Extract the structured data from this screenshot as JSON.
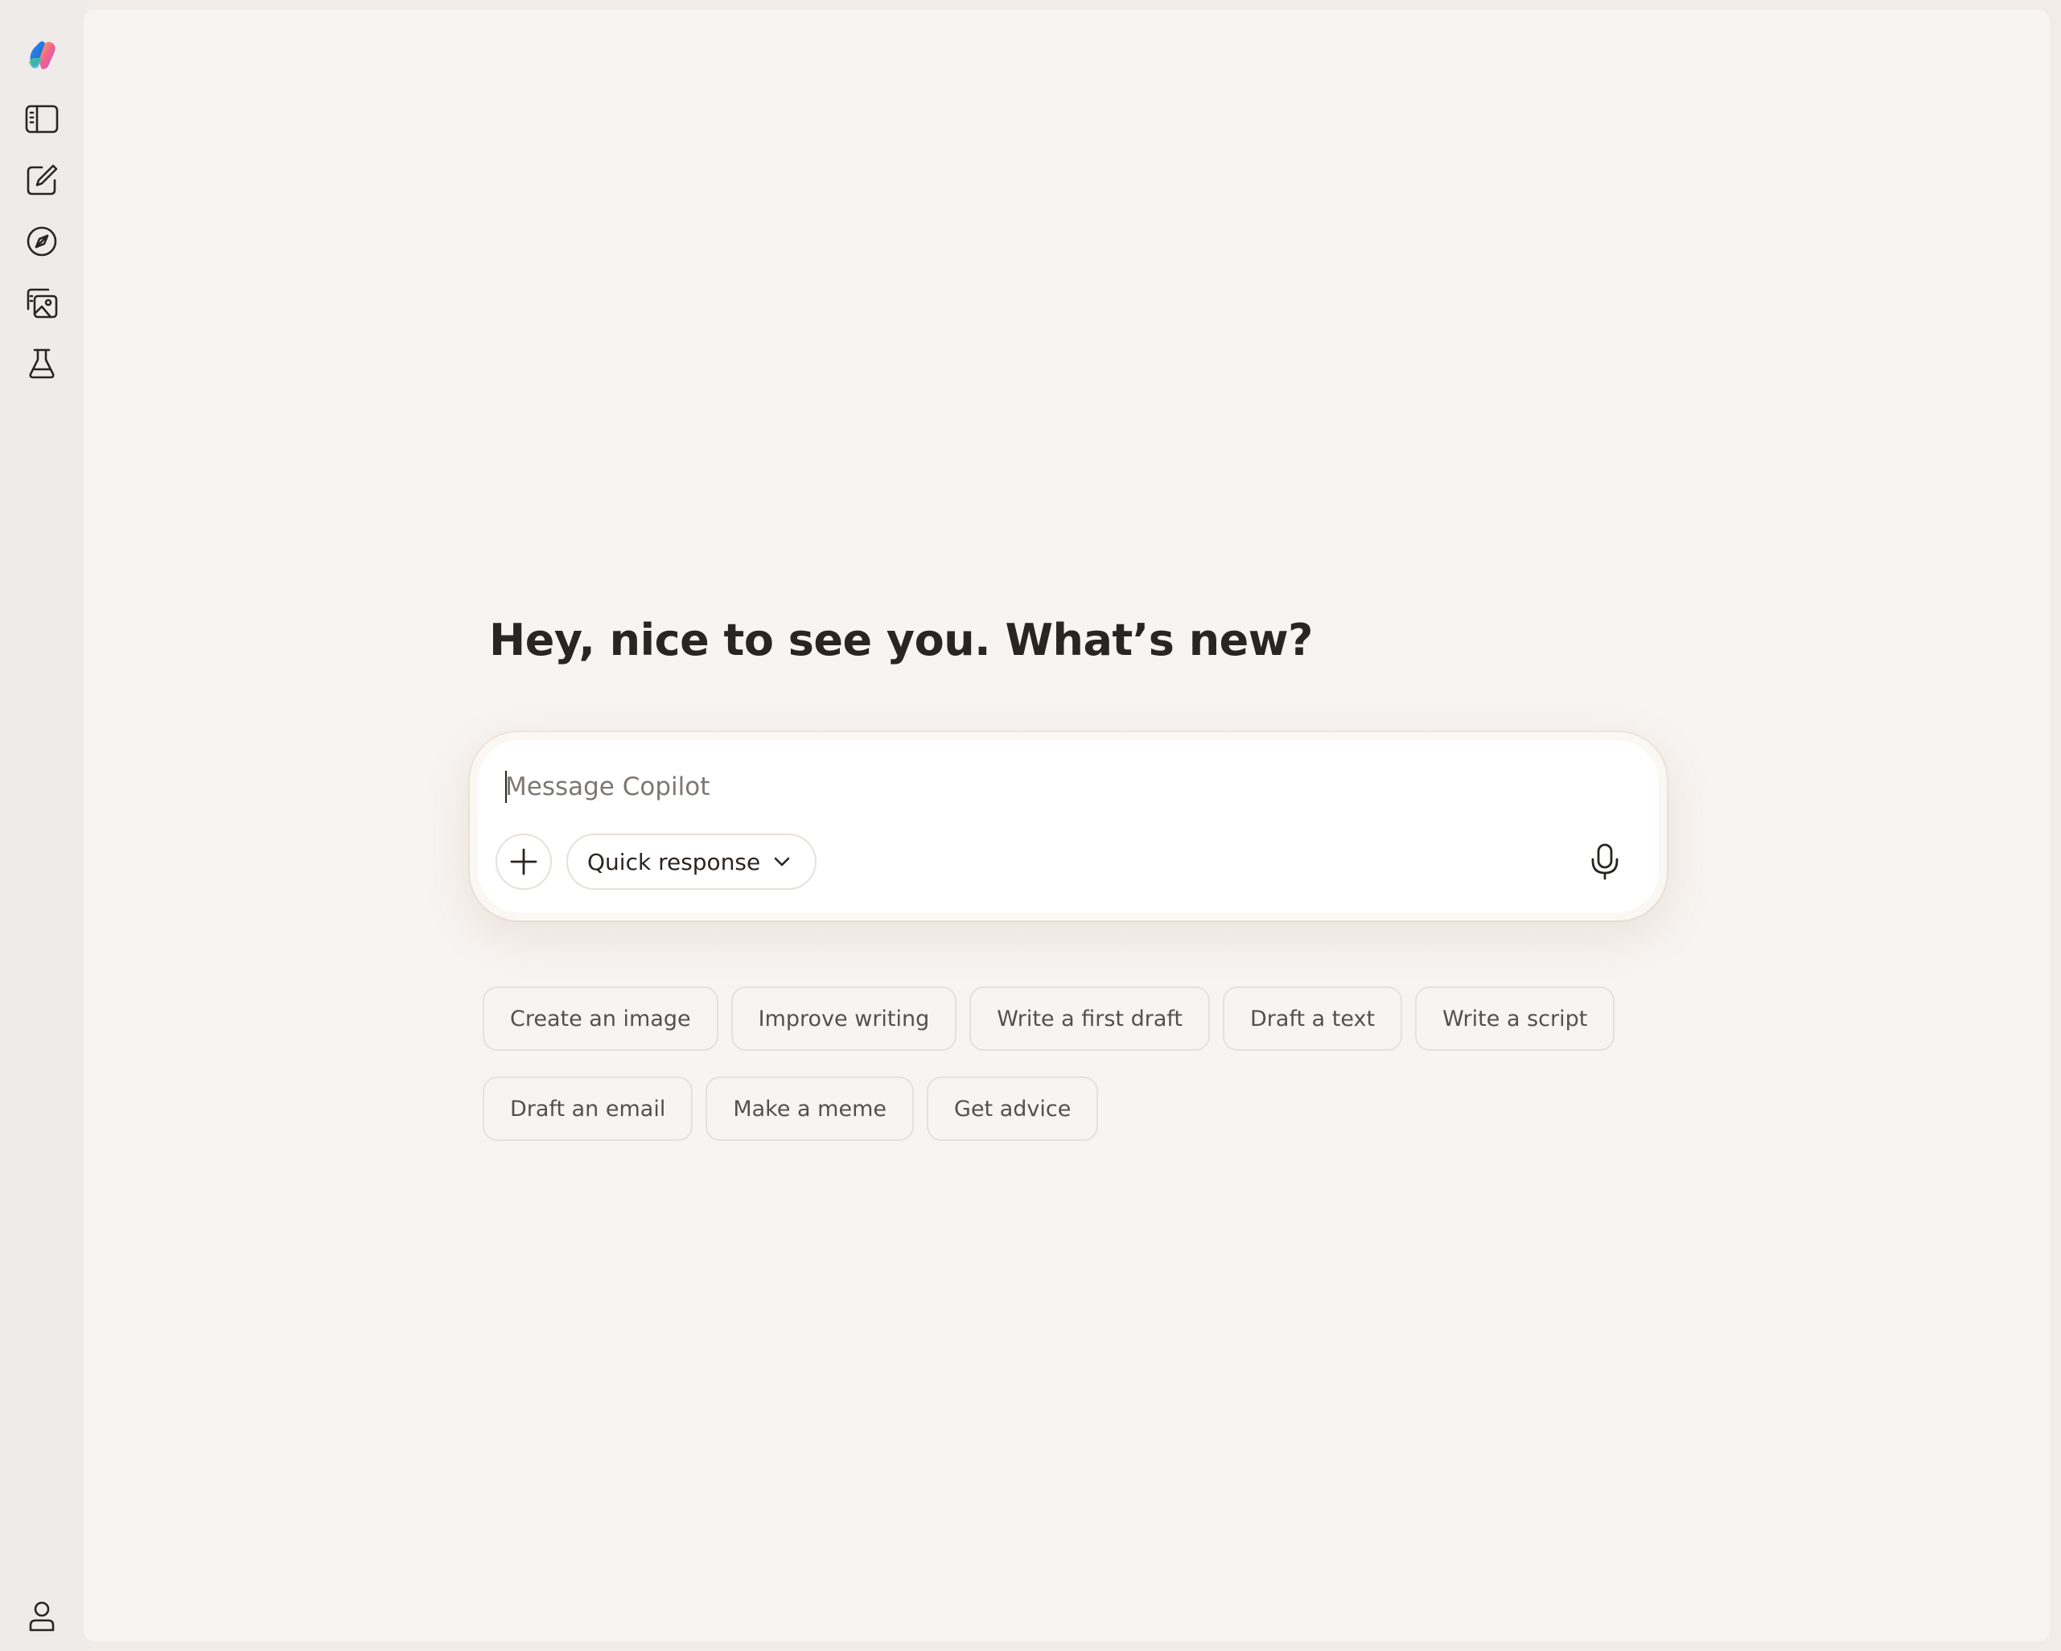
{
  "sidebar": {
    "items": [
      {
        "id": "logo",
        "icon": "copilot-logo-icon"
      },
      {
        "id": "toggle-sidebar",
        "icon": "sidebar-panel-icon"
      },
      {
        "id": "new-chat",
        "icon": "compose-icon"
      },
      {
        "id": "discover",
        "icon": "compass-icon"
      },
      {
        "id": "images",
        "icon": "image-gallery-icon"
      },
      {
        "id": "labs",
        "icon": "flask-icon"
      }
    ],
    "profile": {
      "icon": "user-icon"
    }
  },
  "main": {
    "greeting": "Hey, nice to see you. What’s new?",
    "composer": {
      "placeholder": "Message Copilot",
      "value": "",
      "mode_label": "Quick response",
      "add_icon": "plus-icon",
      "mode_icon": "chevron-down-icon",
      "mic_icon": "microphone-icon"
    },
    "suggestions": [
      "Create an image",
      "Improve writing",
      "Write a first draft",
      "Draft a text",
      "Write a script",
      "Draft an email",
      "Make a meme",
      "Get advice"
    ]
  },
  "colors": {
    "rail_bg": "#efebe8",
    "main_bg": "#f8f4f1",
    "text_primary": "#2a2522",
    "text_secondary": "#55504c",
    "placeholder": "#7d7773",
    "border": "#e7e1dc"
  }
}
